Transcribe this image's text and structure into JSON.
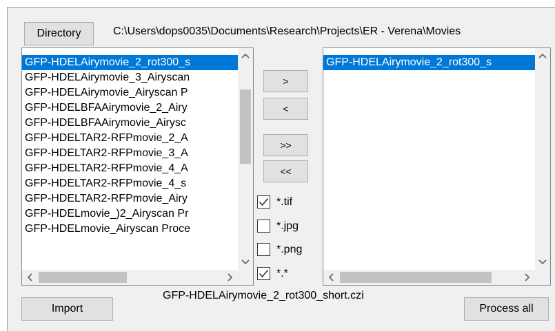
{
  "directory_button": "Directory",
  "directory_path": "C:\\Users\\dops0035\\Documents\\Research\\Projects\\ER - Verena\\Movies",
  "source_list": {
    "items": [
      "GFP-HDELAirymovie_2_rot300_s",
      "GFP-HDELAirymovie_3_Airyscan",
      "GFP-HDELAirymovie_Airyscan P",
      "GFP-HDELBFAAirymovie_2_Airy",
      "GFP-HDELBFAAirymovie_Airysc",
      "GFP-HDELTAR2-RFPmovie_2_A",
      "GFP-HDELTAR2-RFPmovie_3_A",
      "GFP-HDELTAR2-RFPmovie_4_A",
      "GFP-HDELTAR2-RFPmovie_4_s",
      "GFP-HDELTAR2-RFPmovie_Airy",
      "GFP-HDELmovie_)2_Airyscan Pr",
      "GFP-HDELmovie_Airyscan Proce"
    ],
    "selected_index": 0
  },
  "target_list": {
    "items": [
      "GFP-HDELAirymovie_2_rot300_s"
    ],
    "selected_index": 0
  },
  "transfer_buttons": {
    "add_one": ">",
    "remove_one": "<",
    "add_all": ">>",
    "remove_all": "<<"
  },
  "filters": [
    {
      "label": "*.tif",
      "checked": true
    },
    {
      "label": "*.jpg",
      "checked": false
    },
    {
      "label": "*.png",
      "checked": false
    },
    {
      "label": "*.*",
      "checked": true
    }
  ],
  "selected_file": "GFP-HDELAirymovie_2_rot300_short.czi",
  "import_button": "Import",
  "process_all_button": "Process all",
  "colors": {
    "selection": "#0078d7",
    "panel": "#f0f0f0",
    "button": "#e1e1e1"
  }
}
